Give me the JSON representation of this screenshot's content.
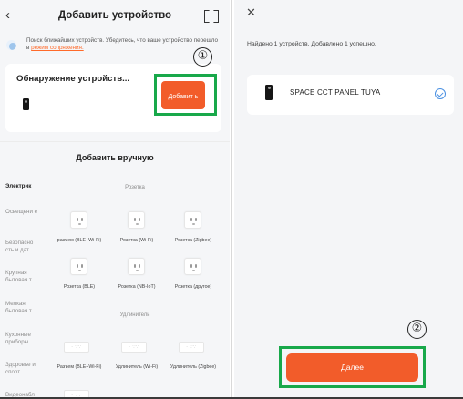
{
  "left": {
    "title": "Добавить устройство",
    "hint_text": "Поиск ближайших устройств. Убедитесь, что ваше устройство перешло в ",
    "hint_link": "режим сопряжения.",
    "card_title": "Обнаружение устройств...",
    "add_button": "Добавит ь",
    "annotation1": "①",
    "manual_title": "Добавить вручную",
    "categories": [
      "Электрик",
      "Освещени е",
      "Безопасно сть и дат...",
      "Крупная бытовая т...",
      "Мелкая бытовая т...",
      "Кухонные приборы",
      "Здоровье и спорт",
      "Видеонабл"
    ],
    "section_socket": "Розетка",
    "section_extender": "Удлинитель",
    "socket_labels": [
      "разъем (BLE+Wi-Fi)",
      "Розетка (Wi-Fi)",
      "Розетка (Zigbee)",
      "Розетка (BLE)",
      "Розетка (NB-IoT)",
      "Розетка (другое)"
    ],
    "extender_labels": [
      "Разъем (BLE+Wi-Fi)",
      "Удлинитель (Wi-Fi)",
      "Удлинитель (Zigbee)"
    ],
    "strip_glyph": "· ∵∵"
  },
  "right": {
    "close_glyph": "✕",
    "found_text": "Найдено 1 устройств. Добавлено 1 успешно.",
    "device_name": "SPACE CCT PANEL TUYA",
    "annotation2": "②",
    "next_button": "Далее"
  },
  "icons": {
    "back": "‹"
  },
  "colors": {
    "accent": "#f25c2a",
    "highlight": "#18a84a",
    "check": "#4a90e2"
  }
}
